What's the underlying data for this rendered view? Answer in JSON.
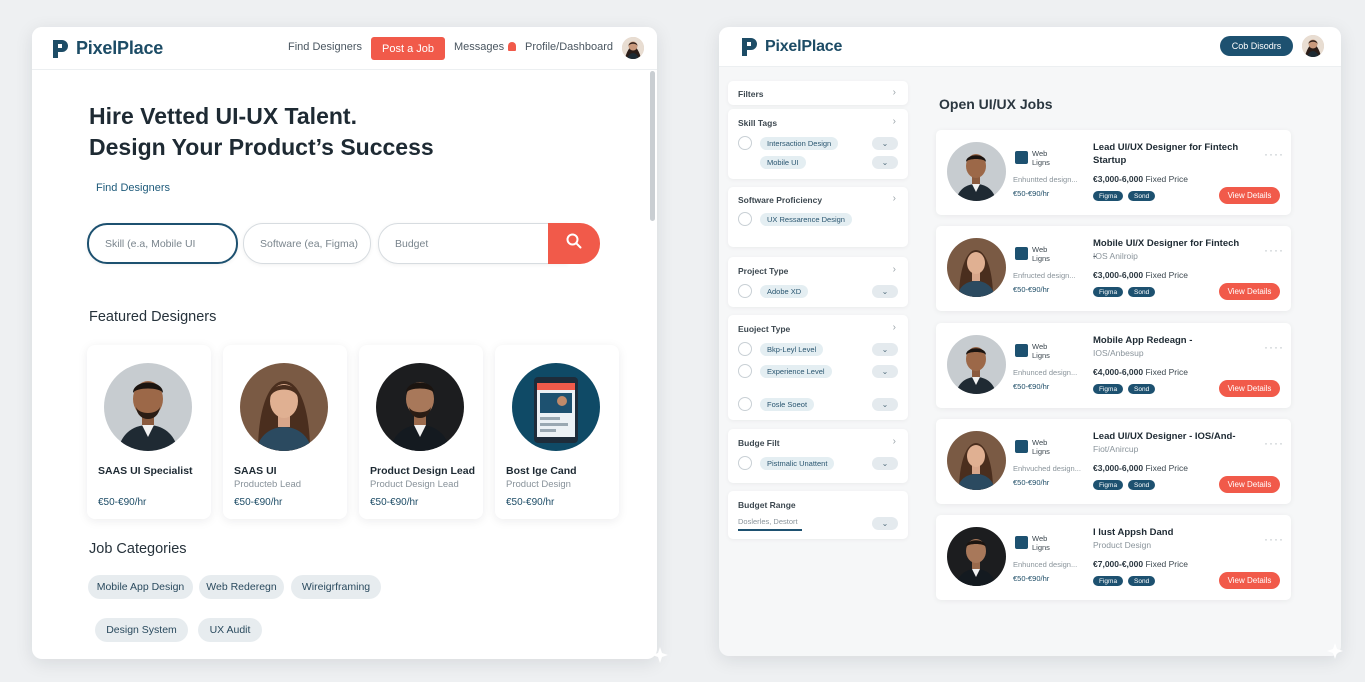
{
  "left": {
    "brand": "PixelPlace",
    "nav": {
      "find_designers": "Find Designers",
      "post_job": "Post a Job",
      "messages": "Messages",
      "profile": "Profile/Dashboard"
    },
    "hero": {
      "title_line1": "Hire Vetted UI-UX Talent.",
      "title_line2": "Design Your Product’s Success",
      "link": "Find Designers"
    },
    "search": {
      "skill_placeholder": "Skill (e.a, Mobile UI",
      "software_placeholder": "Software (ea, Figma)",
      "budget_placeholder": "Budget"
    },
    "featured_title": "Featured Designers",
    "designers": [
      {
        "name": "SAAS UI Specialist",
        "role": "",
        "rate": "€50-€90/hr"
      },
      {
        "name": "SAAS UI",
        "role": "Producteb Lead",
        "rate": "€50-€90/hr"
      },
      {
        "name": "Product Design Lead",
        "role": "Product Design Lead",
        "rate": "€50-€90/hr"
      },
      {
        "name": "Bost Ige Cand",
        "role": "Product Design",
        "rate": "€50-€90/hr"
      }
    ],
    "categories_title": "Job Categories",
    "categories": [
      "Mobile App Design",
      "Web Rederegn",
      "Wireigrframing",
      "Design System",
      "UX Audit"
    ]
  },
  "right": {
    "brand": "PixelPlace",
    "header_button": "Cob Disodrs",
    "filters": {
      "title": "Filters",
      "skill_tags": {
        "title": "Skill Tags",
        "items": [
          "Intersaction Design",
          "Mobile UI"
        ]
      },
      "software": {
        "title": "Software Proficiency",
        "items": [
          "UX Ressarence Design"
        ]
      },
      "project_type": {
        "title": "Project Type",
        "items": [
          "Adobe XD"
        ]
      },
      "experience": {
        "title": "Euoject Type",
        "items": [
          "Bkp-Leyl Level",
          "Experience Level",
          "Fosle Soeot"
        ]
      },
      "budget_filt": {
        "title": "Budge Filt",
        "items": [
          "Pistmalic Unattent"
        ]
      },
      "budget_range": {
        "title": "Budget Range",
        "value": "Doslerles, Destort"
      }
    },
    "open_jobs_title": "Open UI/UX Jobs",
    "jobs": [
      {
        "title": "Lead UI/UX Designer for Fintech Startup",
        "sub": "",
        "price": "€3,000-6,000",
        "price_type": "Fixed Price",
        "desc": "Enhuntted design...",
        "rate": "€50-€90/hr",
        "tags": [
          "Figma",
          "Sond"
        ]
      },
      {
        "title": "Mobile UI/X Designer for Fintech -",
        "sub": "IOS Anilroip",
        "price": "€3,000-6,000",
        "price_type": "Fixed Price",
        "desc": "Enfructed design...",
        "rate": "€50-€90/hr",
        "tags": [
          "Figma",
          "Sond"
        ]
      },
      {
        "title": "Mobile App Redeagn -",
        "sub": "IOS/Anbesup",
        "price": "€4,000-6,000",
        "price_type": "Fixed Price",
        "desc": "Enhunced design...",
        "rate": "€50-€90/hr",
        "tags": [
          "Figma",
          "Sond"
        ]
      },
      {
        "title": "Lead UI/UX Designer - IOS/And-",
        "sub": "Fiot/Anircup",
        "price": "€3,000-6,000",
        "price_type": "Fixed Price",
        "desc": "Enhvuched design...",
        "rate": "€50-€90/hr",
        "tags": [
          "Figma",
          "Sond"
        ]
      },
      {
        "title": "I lust Appsh Dand",
        "sub": "Product Design",
        "price": "€7,000-€,000",
        "price_type": "Fixed Price",
        "desc": "Enhunced design...",
        "rate": "€50-€90/hr",
        "tags": [
          "Figma",
          "Sond"
        ]
      }
    ],
    "job_company": "Web Ligns",
    "view_details": "View Details"
  }
}
